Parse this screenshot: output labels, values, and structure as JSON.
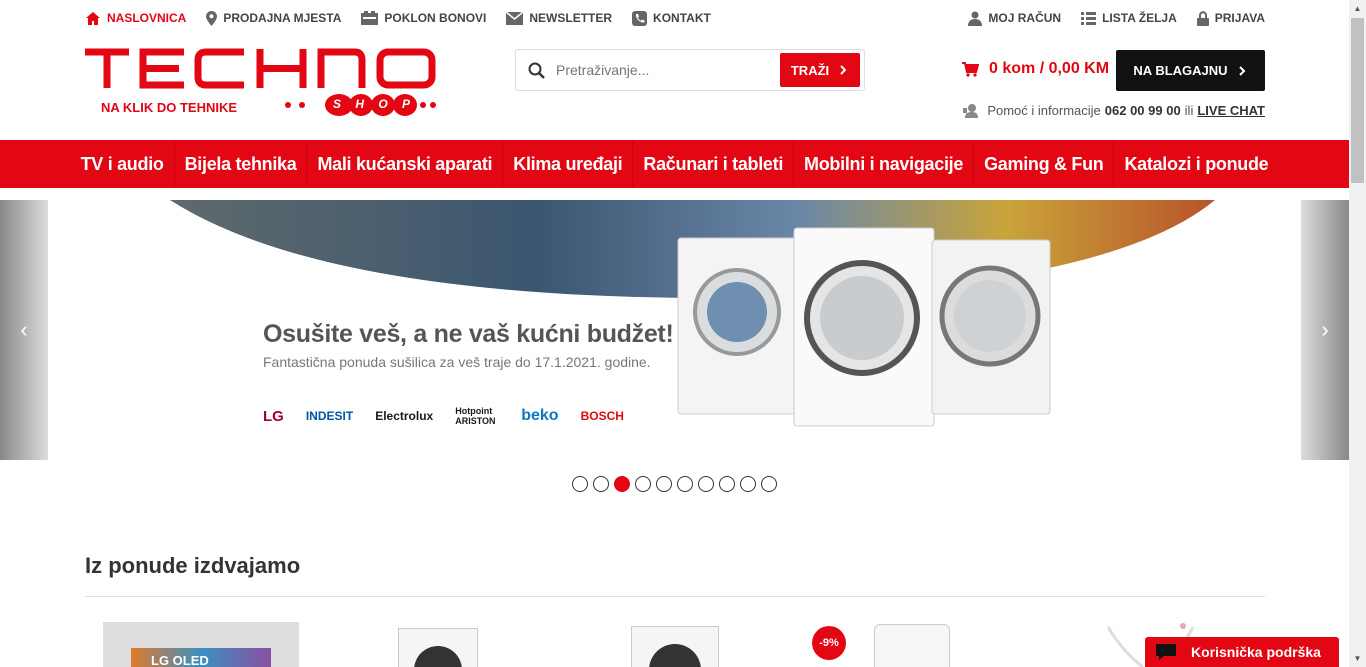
{
  "topbar": {
    "left": [
      {
        "label": "NASLOVNICA",
        "icon": "home-icon",
        "active": true
      },
      {
        "label": "PRODAJNA MJESTA",
        "icon": "location-pin-icon"
      },
      {
        "label": "POKLON BONOVI",
        "icon": "gift-card-icon"
      },
      {
        "label": "NEWSLETTER",
        "icon": "envelope-icon"
      },
      {
        "label": "KONTAKT",
        "icon": "phone-icon"
      }
    ],
    "right": [
      {
        "label": "MOJ RAČUN",
        "icon": "user-icon"
      },
      {
        "label": "LISTA ŽELJA",
        "icon": "list-icon"
      },
      {
        "label": "PRIJAVA",
        "icon": "lock-icon"
      }
    ]
  },
  "logo": {
    "main": "TECHNO",
    "badge": "SHOP",
    "tagline": "NA KLIK DO TEHNIKE"
  },
  "search": {
    "placeholder": "Pretraživanje...",
    "button": "TRAŽI"
  },
  "cart": {
    "label": "0 kom / 0,00 KM"
  },
  "checkout": {
    "label": "NA BLAGAJNU"
  },
  "help": {
    "text": "Pomoć i informacije",
    "phone": "062 00 99 00",
    "or": "ili",
    "chat": "LIVE CHAT"
  },
  "nav": [
    "TV i audio",
    "Bijela tehnika",
    "Mali kućanski aparati",
    "Klima uređaji",
    "Računari i tableti",
    "Mobilni i navigacije",
    "Gaming & Fun",
    "Katalozi i ponude"
  ],
  "hero": {
    "headline": "Osušite veš, a ne vaš kućni budžet!",
    "sub": "Fantastična ponuda sušilica za veš traje do 17.1.2021. godine.",
    "brands": [
      "LG",
      "INDESIT",
      "Electrolux",
      "Hotpoint ARISTON",
      "beko",
      "BOSCH"
    ],
    "slides": 10,
    "active_slide": 3
  },
  "section": {
    "title": "Iz ponude izdvajamo"
  },
  "products": [
    {
      "name": "LG OLED"
    },
    {
      "name": "washer-1"
    },
    {
      "name": "washer-2"
    },
    {
      "name": "air-purifier",
      "badge": "-9%"
    },
    {
      "name": "accessory"
    }
  ],
  "support": {
    "label": "Korisnička podrška"
  },
  "colors": {
    "accent": "#e30613",
    "dark": "#111111"
  }
}
